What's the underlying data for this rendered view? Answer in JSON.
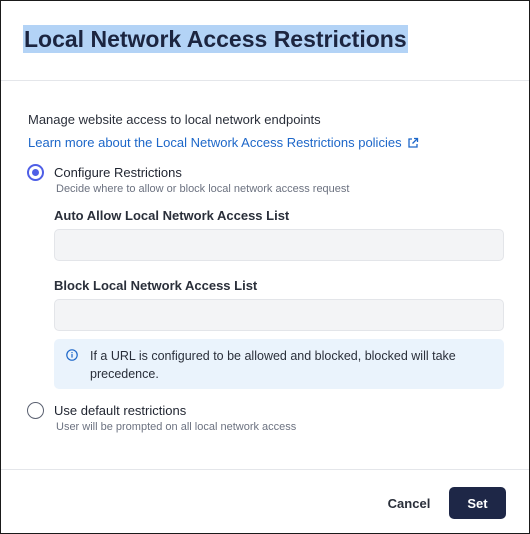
{
  "dialog": {
    "title": "Local Network Access Restrictions",
    "description": "Manage website access to local network endpoints",
    "learn_more_link": "Learn more about the Local Network Access Restrictions policies",
    "options": [
      {
        "label": "Configure Restrictions",
        "sublabel": "Decide where to allow or block local network access request",
        "selected": true
      },
      {
        "label": "Use default restrictions",
        "sublabel": "User will be prompted on all local network access",
        "selected": false
      }
    ],
    "fields": {
      "allow_label": "Auto Allow Local Network Access List",
      "allow_value": "",
      "block_label": "Block Local Network Access List",
      "block_value": ""
    },
    "info_text": "If a URL is configured to be allowed and blocked, blocked will take precedence.",
    "buttons": {
      "cancel": "Cancel",
      "set": "Set"
    }
  },
  "colors": {
    "accent": "#4f5fe6",
    "link": "#1d67c9",
    "primary_button": "#1e2747",
    "info_bg": "#eaf3fc",
    "title_highlight": "#b3d3f6"
  }
}
